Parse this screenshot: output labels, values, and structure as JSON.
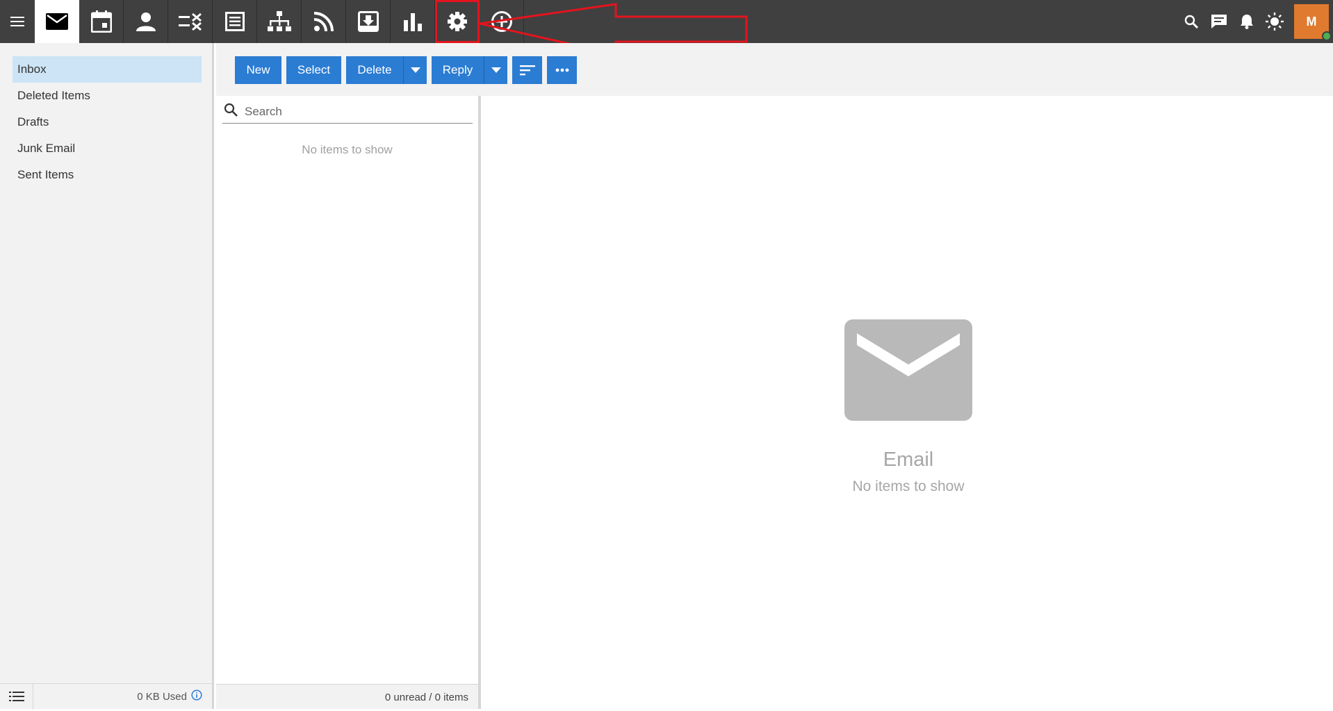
{
  "topbar": {
    "apps": [
      {
        "icon": "mail-icon",
        "active": true
      },
      {
        "icon": "calendar-icon"
      },
      {
        "icon": "contacts-icon"
      },
      {
        "icon": "tasks-icon"
      },
      {
        "icon": "notes-icon"
      },
      {
        "icon": "org-chart-icon"
      },
      {
        "icon": "rss-icon"
      },
      {
        "icon": "archive-icon"
      },
      {
        "icon": "reports-icon"
      },
      {
        "icon": "settings-icon",
        "highlighted": true
      },
      {
        "icon": "add-circle-icon"
      }
    ],
    "right_icons": [
      "search-icon",
      "chat-icon",
      "bell-icon",
      "theme-sun-icon"
    ],
    "avatar_initial": "M",
    "avatar_color": "#e07a2e",
    "status_color": "#4caf50"
  },
  "folders": {
    "items": [
      {
        "label": "Inbox",
        "active": true
      },
      {
        "label": "Deleted Items"
      },
      {
        "label": "Drafts"
      },
      {
        "label": "Junk Email"
      },
      {
        "label": "Sent Items"
      }
    ],
    "usage": "0 KB Used"
  },
  "toolbar": {
    "new_label": "New",
    "select_label": "Select",
    "delete_label": "Delete",
    "reply_label": "Reply",
    "accent_color": "#2b7cd3"
  },
  "list": {
    "search_placeholder": "Search",
    "empty_text": "No items to show",
    "footer": "0 unread / 0 items"
  },
  "reading": {
    "empty_title": "Email",
    "empty_sub": "No items to show"
  },
  "annotation": {
    "highlight_color": "#e3141e"
  }
}
